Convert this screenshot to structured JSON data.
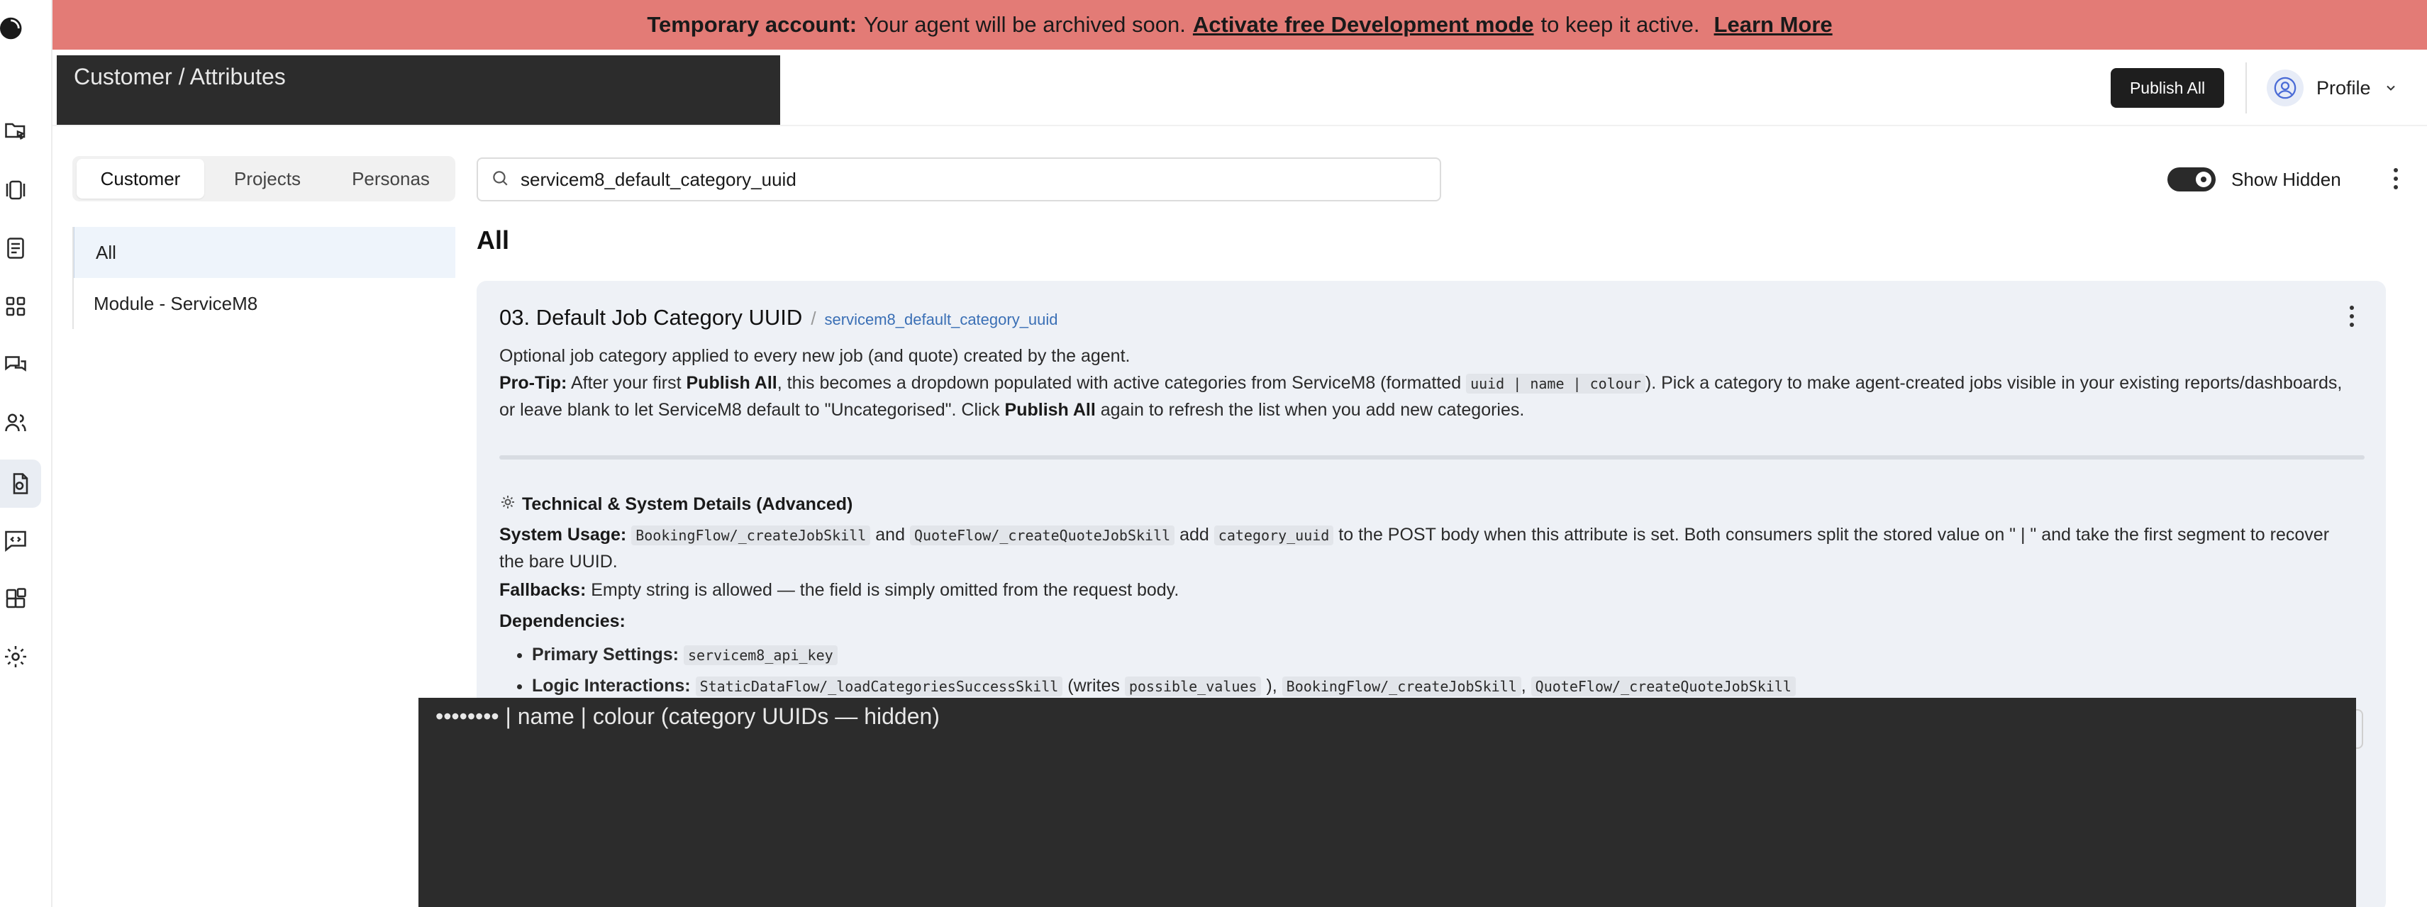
{
  "banner": {
    "lead": "Temporary account:",
    "message": "Your agent will be archived soon.",
    "activate_link": "Activate free Development mode",
    "tail": "to keep it active.",
    "learn_more": "Learn More"
  },
  "header": {
    "breadcrumb": "Customer / Attributes",
    "publish_all": "Publish All",
    "profile": "Profile"
  },
  "tabs": [
    "Customer",
    "Projects",
    "Personas"
  ],
  "categories": [
    "All",
    "Module - ServiceM8"
  ],
  "search": {
    "value": "servicem8_default_category_uuid"
  },
  "show_hidden": "Show Hidden",
  "section_title": "All",
  "card": {
    "title": "03. Default Job Category UUID",
    "key": "servicem8_default_category_uuid",
    "description": "Optional job category applied to every new job (and quote) created by the agent.",
    "protip_label": "Pro-Tip:",
    "protip_1": "After your first",
    "protip_publish": "Publish All",
    "protip_2": ", this becomes a dropdown populated with active categories from ServiceM8 (formatted",
    "protip_code": "uuid | name | colour",
    "protip_3": "). Pick a category to make agent-created jobs visible in your existing reports/dashboards, or leave blank to let ServiceM8 default to \"Uncategorised\". Click",
    "protip_publish2": "Publish All",
    "protip_4": "again to refresh the list when you add new categories.",
    "tech_heading": "Technical & System Details (Advanced)",
    "sys_label": "System Usage:",
    "sys_code1": "BookingFlow/_createJobSkill",
    "sys_and": "and",
    "sys_code2": "QuoteFlow/_createQuoteJobSkill",
    "sys_add": "add",
    "sys_code3": "category_uuid",
    "sys_rest": "to the POST body when this attribute is set. Both consumers split the stored value on \" | \" and take the first segment to recover the bare UUID.",
    "fallbacks_label": "Fallbacks:",
    "fallbacks_text": "Empty string is allowed — the field is simply omitted from the request body.",
    "deps_label": "Dependencies:",
    "primary_label": "Primary Settings:",
    "primary_code": "servicem8_api_key",
    "logic_label": "Logic Interactions:",
    "logic_code1": "StaticDataFlow/_loadCategoriesSuccessSkill",
    "logic_writes": "(writes",
    "logic_code2": "possible_values",
    "logic_close": "),",
    "logic_code3": "BookingFlow/_createJobSkill",
    "logic_comma": ",",
    "logic_code4": "QuoteFlow/_createQuoteJobSkill"
  },
  "overlay_text": "•••••••• | name | colour (category UUIDs — hidden)"
}
